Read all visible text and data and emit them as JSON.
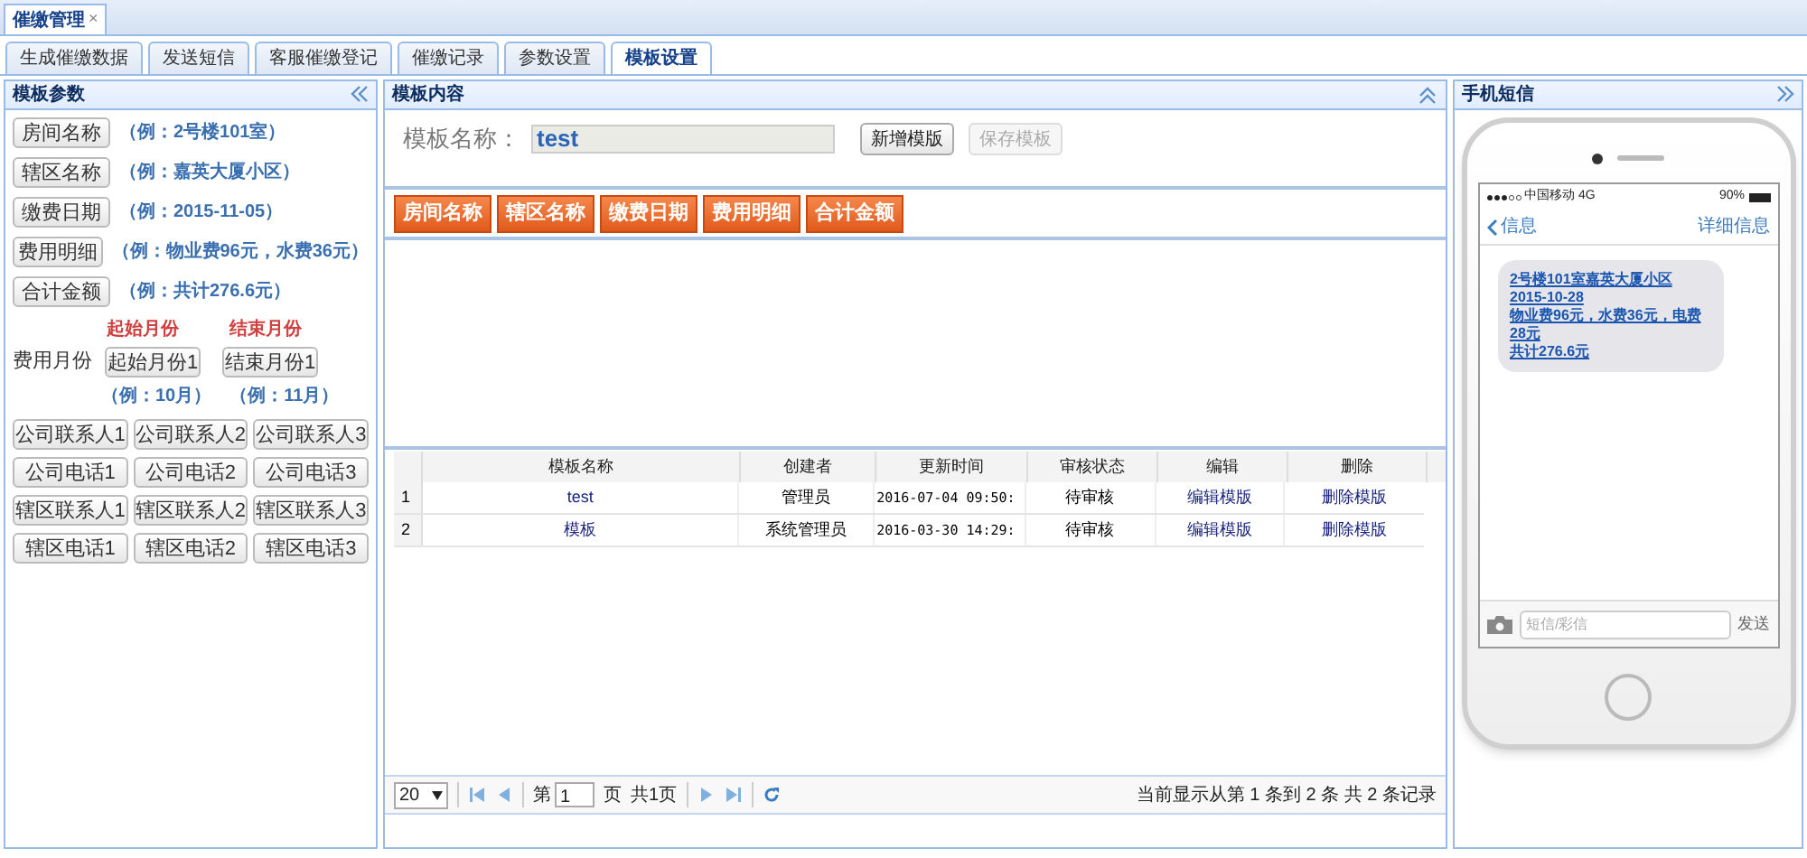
{
  "app_tab": {
    "label": "催缴管理",
    "close": "×"
  },
  "tabs": [
    {
      "label": "生成催缴数据",
      "selected": false
    },
    {
      "label": "发送短信",
      "selected": false
    },
    {
      "label": "客服催缴登记",
      "selected": false
    },
    {
      "label": "催缴记录",
      "selected": false
    },
    {
      "label": "参数设置",
      "selected": false
    },
    {
      "label": "模板设置",
      "selected": true
    }
  ],
  "left_panel": {
    "title": "模板参数",
    "fields": [
      {
        "button": "房间名称",
        "example": "（例：2号楼101室）"
      },
      {
        "button": "辖区名称",
        "example": "（例：嘉英大厦小区）"
      },
      {
        "button": "缴费日期",
        "example": "（例：2015-11-05）"
      },
      {
        "button": "费用明细",
        "example": "（例：物业费96元，水费36元）"
      },
      {
        "button": "合计金额",
        "example": "（例：共计276.6元）"
      }
    ],
    "month": {
      "label": "费用月份",
      "start_heading": "起始月份",
      "end_heading": "结束月份",
      "start_button": "起始月份1",
      "end_button": "结束月份1",
      "start_example": "（例：10月）",
      "end_example": "（例：11月）"
    },
    "contact_buttons": [
      "公司联系人1",
      "公司联系人2",
      "公司联系人3",
      "公司电话1",
      "公司电话2",
      "公司电话3",
      "辖区联系人1",
      "辖区联系人2",
      "辖区联系人3",
      "辖区电话1",
      "辖区电话2",
      "辖区电话3"
    ]
  },
  "center": {
    "title": "模板内容",
    "name_label": "模板名称：",
    "name_value": "test",
    "add_button": {
      "label": "新增模版",
      "disabled": false
    },
    "save_button": {
      "label": "保存模板",
      "disabled": true
    },
    "tokens": [
      "房间名称",
      "辖区名称",
      "缴费日期",
      "费用明细",
      "合计金额"
    ],
    "table": {
      "columns": [
        "模板名称",
        "创建者",
        "更新时间",
        "审核状态",
        "编辑",
        "删除"
      ],
      "rows": [
        {
          "index": "1",
          "name": "test",
          "creator": "管理员",
          "updated": "2016-07-04 09:50:",
          "status": "待审核",
          "edit": "编辑模版",
          "delete": "删除模版"
        },
        {
          "index": "2",
          "name": "模板",
          "creator": "系统管理员",
          "updated": "2016-03-30 14:29:",
          "status": "待审核",
          "edit": "编辑模版",
          "delete": "删除模版"
        }
      ]
    },
    "pager": {
      "page_size": "20",
      "page_prefix": "第",
      "page": "1",
      "page_suffix": "页",
      "total_pages": "共1页",
      "summary": "当前显示从第 1 条到 2 条 共 2 条记录"
    }
  },
  "phone": {
    "title": "手机短信",
    "carrier": "中国移动",
    "network": "4G",
    "battery": "90%",
    "back": "信息",
    "details": "详细信息",
    "message_lines": [
      "2号楼101室嘉英大厦小区",
      "2015-10-28",
      "物业费96元，水费36元，电费28元",
      "共计276.6元"
    ],
    "input_placeholder": "短信/彩信",
    "send": "发送"
  }
}
